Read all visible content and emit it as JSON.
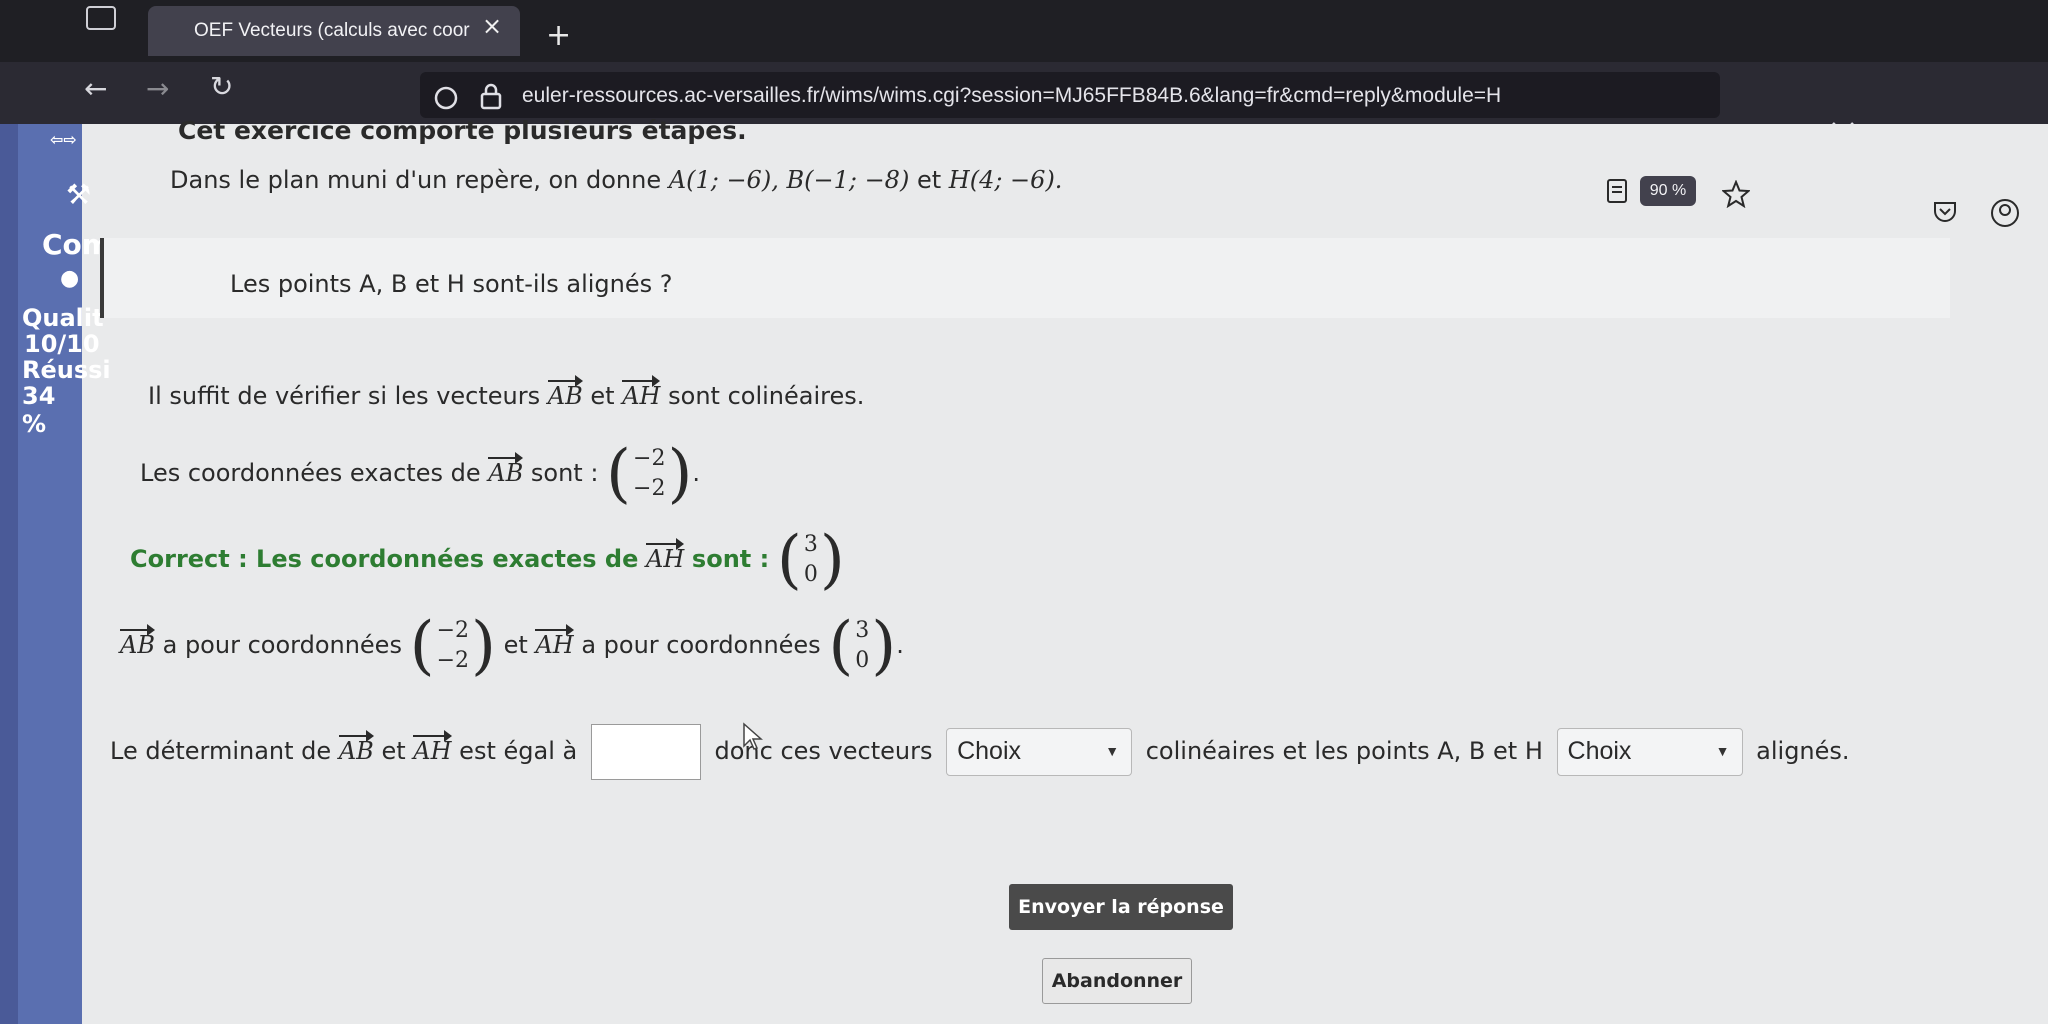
{
  "browser": {
    "tab_title": "OEF Vecteurs (calculs avec coor",
    "tab_close": "×",
    "new_tab": "+",
    "url": "euler-ressources.ac-versailles.fr/wims/wims.cgi?session=MJ65FFB84B.6&lang=fr&cmd=reply&module=H",
    "zoom": "90 %",
    "icons": [
      "back-icon",
      "forward-icon",
      "reload-icon",
      "shield-icon",
      "lock-icon",
      "reader-mode-icon",
      "star-icon",
      "pocket-icon",
      "account-icon",
      "chevron-down-icon"
    ]
  },
  "sidebar": {
    "item1": "Com",
    "item2": "Qualit",
    "item3": "10/10",
    "item4": "Réussi",
    "item5": "34 %"
  },
  "exercise": {
    "steps_title": "Cet exercice comporte plusieurs étapes.",
    "intro_prefix": "Dans le plan muni d'un repère, on donne",
    "point_a": "A(1; −6),",
    "point_b": "B(−1; −8)",
    "intro_and": "et",
    "point_h": "H(4; −6).",
    "question": "Les points A, B et H sont-ils alignés ?",
    "hint_prefix": "Il suffit de vérifier si les vecteurs",
    "vec_ab": "AB",
    "vec_ah": "AH",
    "et": "et",
    "hint_suffix": "sont colinéaires.",
    "ab_coords_prefix": "Les coordonnées exactes de",
    "ab_coords_mid": "sont :",
    "ab_x": "−2",
    "ab_y": "−2",
    "period": ".",
    "correct_prefix": "Correct : Les coordonnées exactes de",
    "correct_mid": "sont :",
    "ah_x": "3",
    "ah_y": "0",
    "summary_mid1": "a pour coordonnées",
    "summary_mid2": "a pour coordonnées",
    "det_prefix": "Le déterminant de",
    "det_mid": "est égal à",
    "det_suffix": "donc ces vecteurs",
    "select1": "Choix",
    "colinear_text": "colinéaires et les points A, B et H",
    "select2": "Choix",
    "aligned_text": "alignés.",
    "submit": "Envoyer la réponse",
    "cancel": "Abandonner"
  }
}
